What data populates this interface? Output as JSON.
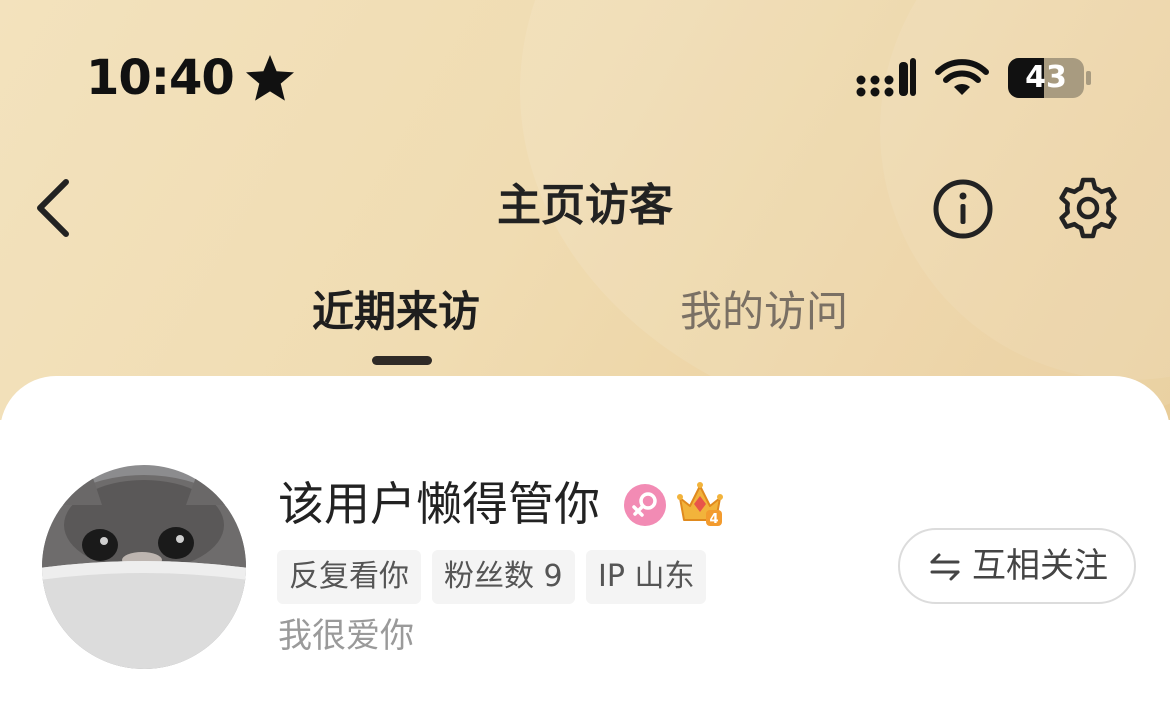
{
  "status_bar": {
    "time": "10:40",
    "battery": "43",
    "icons": [
      "star-icon",
      "signal-icon",
      "wifi-icon",
      "battery-icon"
    ]
  },
  "nav": {
    "title": "主页访客",
    "icons": [
      "back-icon",
      "info-icon",
      "gear-icon"
    ]
  },
  "tabs": [
    {
      "label": "近期来访",
      "active": true
    },
    {
      "label": "我的访问",
      "active": false
    }
  ],
  "colors": {
    "header_gradient_start": "#f3e2bd",
    "header_gradient_end": "#e8cc98",
    "tab_active": "#1e1e1e",
    "tab_inactive": "#7a7064",
    "female_badge": "#f28bb4"
  },
  "visitors": [
    {
      "name": "该用户懒得管你",
      "badges": [
        "female-icon",
        "crown-level-icon"
      ],
      "crown_level": "4",
      "tags": [
        "反复看你",
        "粉丝数 9",
        "IP 山东"
      ],
      "signature": "我很爱你",
      "follow_label": "互相关注",
      "follow_icon": "mutual-arrows-icon"
    }
  ]
}
